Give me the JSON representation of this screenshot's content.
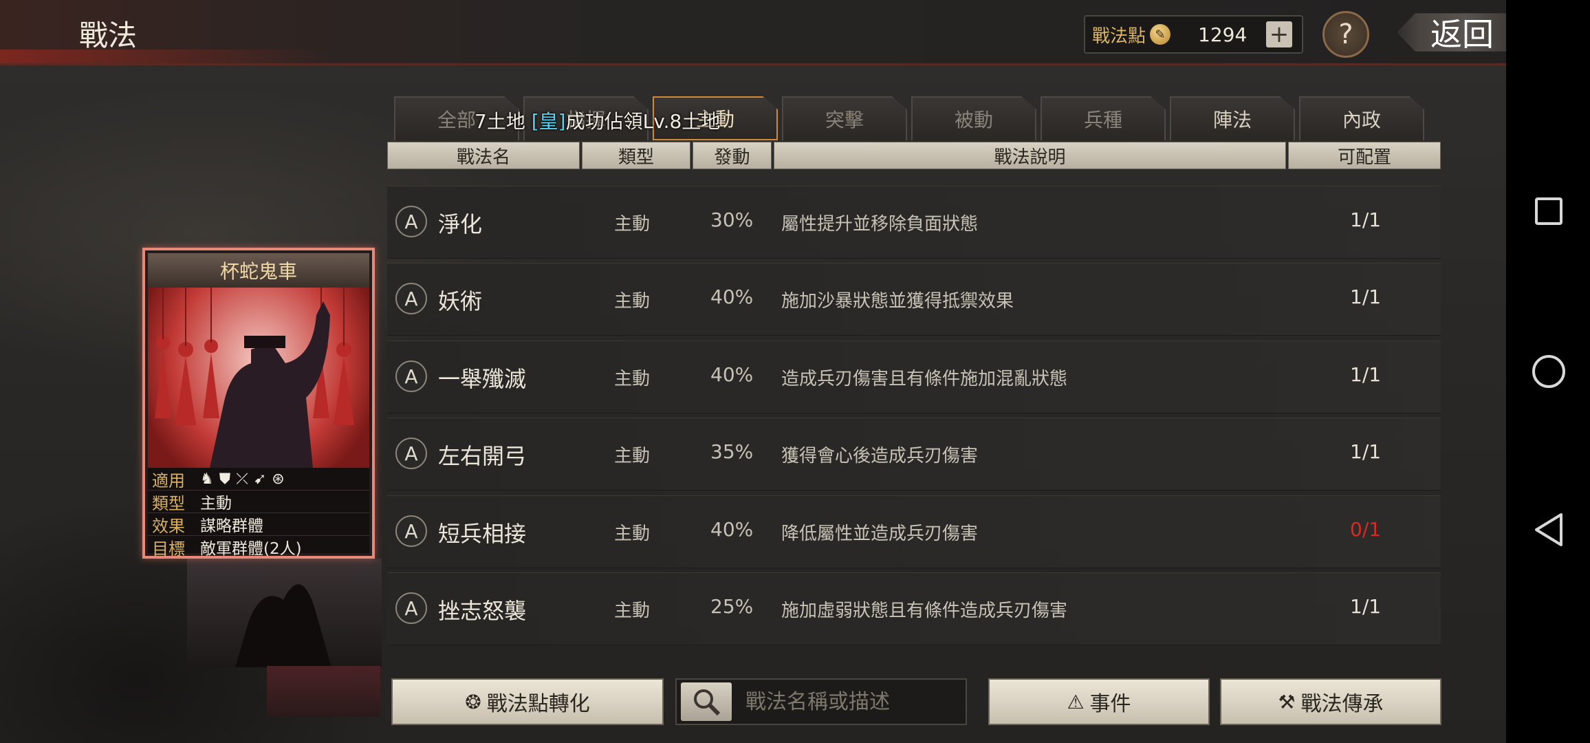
{
  "header": {
    "title": "戰法",
    "points_label": "戰法點",
    "points_value": "1294",
    "add_label": "+",
    "help_label": "?",
    "back_label": "返回"
  },
  "tabs": [
    {
      "label": "全部",
      "state": "normal"
    },
    {
      "label": "指揮",
      "state": "normal"
    },
    {
      "label": "主動",
      "state": "active"
    },
    {
      "label": "突擊",
      "state": "dim"
    },
    {
      "label": "被動",
      "state": "dim"
    },
    {
      "label": "兵種",
      "state": "dim"
    },
    {
      "label": "陣法",
      "state": "bright"
    },
    {
      "label": "內政",
      "state": "bright"
    }
  ],
  "notice": {
    "prefix": "7土地",
    "tag": "[皇]",
    "text": "成功佔領Lv.8土地"
  },
  "columns": [
    "戰法名",
    "類型",
    "發動",
    "戰法說明",
    "可配置"
  ],
  "rows": [
    {
      "grade": "A",
      "name": "淨化",
      "type": "主動",
      "rate": "30%",
      "desc": "屬性提升並移除負面狀態",
      "slots": "1/1"
    },
    {
      "grade": "A",
      "name": "妖術",
      "type": "主動",
      "rate": "40%",
      "desc": "施加沙暴狀態並獲得抵禦效果",
      "slots": "1/1"
    },
    {
      "grade": "A",
      "name": "一舉殲滅",
      "type": "主動",
      "rate": "40%",
      "desc": "造成兵刃傷害且有條件施加混亂狀態",
      "slots": "1/1"
    },
    {
      "grade": "A",
      "name": "左右開弓",
      "type": "主動",
      "rate": "35%",
      "desc": "獲得會心後造成兵刃傷害",
      "slots": "1/1"
    },
    {
      "grade": "A",
      "name": "短兵相接",
      "type": "主動",
      "rate": "40%",
      "desc": "降低屬性並造成兵刃傷害",
      "slots": "0/1"
    },
    {
      "grade": "A",
      "name": "挫志怒襲",
      "type": "主動",
      "rate": "25%",
      "desc": "施加虛弱狀態且有條件造成兵刃傷害",
      "slots": "1/1"
    }
  ],
  "card": {
    "name": "杯蛇鬼車",
    "apply_label": "適用",
    "apply_icons": [
      "cavalry-icon",
      "shield-icon",
      "bow-icon",
      "spear-icon",
      "wheel-icon"
    ],
    "type_label": "類型",
    "type_value": "主動",
    "effect_label": "效果",
    "effect_value": "謀略群體",
    "target_label": "目標",
    "target_value": "敵軍群體(2人)"
  },
  "bottom": {
    "convert_label": "戰法點轉化",
    "search_placeholder": "戰法名稱或描述",
    "event_label": "事件",
    "inherit_label": "戰法傳承"
  }
}
